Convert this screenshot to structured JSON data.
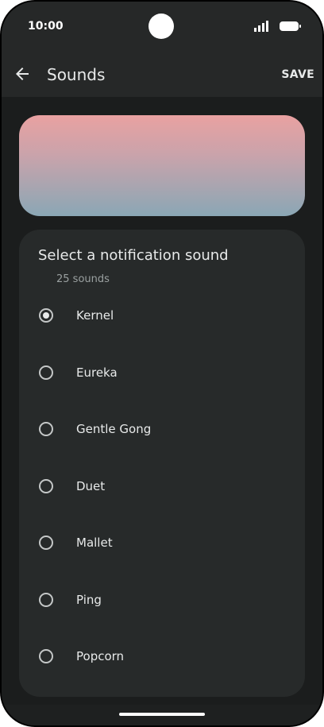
{
  "status_bar": {
    "time": "10:00",
    "icons": [
      "signal-icon",
      "battery-icon"
    ]
  },
  "app_bar": {
    "title": "Sounds",
    "back_icon": "arrow-back-icon",
    "save_label": "SAVE"
  },
  "banner": {
    "gradient_top": "#e9a1a1",
    "gradient_bottom": "#8aa7b5"
  },
  "sound_list": {
    "title": "Select a notification sound",
    "count_label": "25 sounds",
    "items": [
      {
        "label": "Kernel",
        "selected": true
      },
      {
        "label": "Eureka",
        "selected": false
      },
      {
        "label": "Gentle Gong",
        "selected": false
      },
      {
        "label": "Duet",
        "selected": false
      },
      {
        "label": "Mallet",
        "selected": false
      },
      {
        "label": "Ping",
        "selected": false
      },
      {
        "label": "Popcorn",
        "selected": false
      }
    ]
  },
  "colors": {
    "background": "#1b1d1d",
    "card": "#272a2a",
    "text": "#e8eaea"
  }
}
